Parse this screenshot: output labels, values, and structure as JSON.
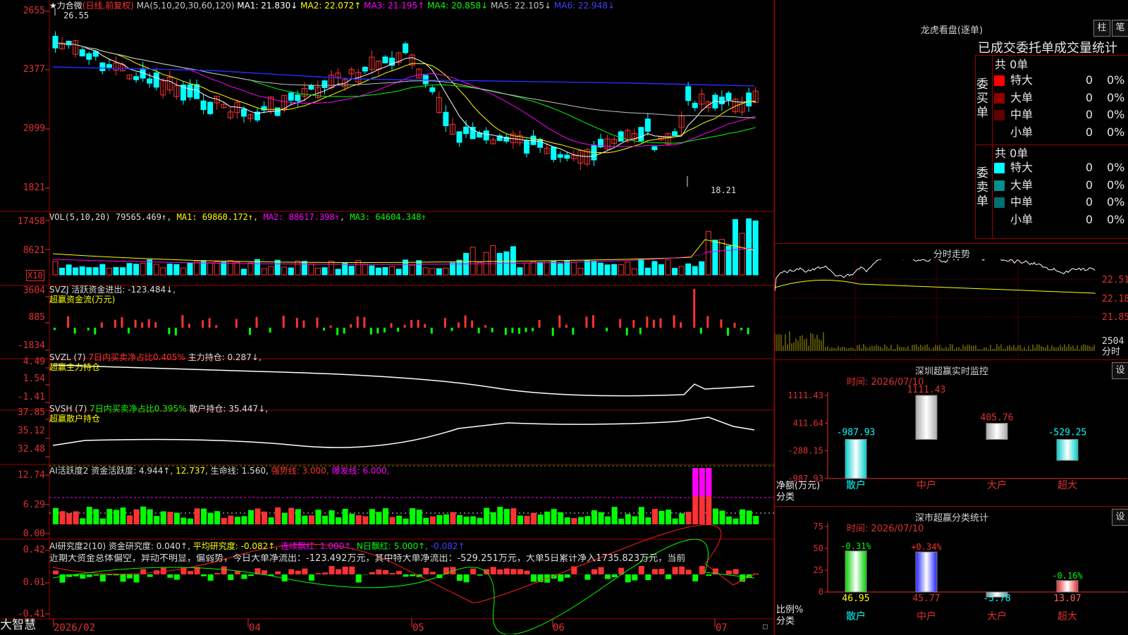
{
  "colors": {
    "up": "#ff3232",
    "down": "#00ffff",
    "ma1": "#ffffff",
    "ma2": "#ffff00",
    "ma3": "#ff00ff",
    "ma4": "#00ff00",
    "ma5": "#c0c0c0",
    "ma6": "#2a2aff",
    "grid": "#a00000"
  },
  "main": {
    "stock_name": "★力合微",
    "mode": "(日线,前复权)",
    "ma_params": "MA(5,10,20,30,60,120)",
    "ma": [
      {
        "label": "MA1: 21.830↓",
        "color": "#ffffff"
      },
      {
        "label": "MA2: 22.072↑",
        "color": "#ffff00"
      },
      {
        "label": "MA3: 21.195↑",
        "color": "#ff00ff"
      },
      {
        "label": "MA4: 20.858↓",
        "color": "#00ff00"
      },
      {
        "label": "MA5: 22.105↓",
        "color": "#c0c0c0"
      },
      {
        "label": "MA6: 22.948↓",
        "color": "#2a2aff"
      }
    ],
    "y_ticks": [
      "2655",
      "2377",
      "2099",
      "1821"
    ],
    "high_marker": "26.55",
    "low_marker": "18.21"
  },
  "vol": {
    "header": "VOL(5,10,20)",
    "value": "79565.469↑",
    "ma1": "MA1: 69860.172↑",
    "ma2": "MA2: 88617.398↑",
    "ma3": "MA3: 64604.348↑",
    "y_ticks": [
      "17458",
      "8621"
    ],
    "unit": "X10"
  },
  "svzj": {
    "header": "SVZJ  活跃资金进出: -123.484↓,",
    "sub": "超赢资金流(万元)",
    "y_ticks": [
      "3604",
      "885",
      "-1834"
    ]
  },
  "svzl": {
    "header": "SVZL (7)",
    "red": "7日内买卖净占比0.405%",
    "tail": "主力持仓: 0.287↓,",
    "sub": "超赢主力持仓",
    "y_ticks": [
      "4.49",
      "1.54",
      "-1.41"
    ]
  },
  "svsh": {
    "header": "SVSH (7)",
    "green": "7日内买卖净占比0.395%",
    "tail": "散户持仓: 35.447↓,",
    "sub": "超赢散户持仓",
    "y_ticks": [
      "37.85",
      "35.12",
      "32.48"
    ]
  },
  "ai1": {
    "a": "AI活跃度2 资金活跃度: 4.944↑,",
    "b": "12.737,",
    "c": "生命线: 1.560,",
    "d": "强势线: 3.000,",
    "e": "爆发线: 6.000,",
    "y_ticks": [
      "12.74",
      "6.29",
      "0.00"
    ]
  },
  "ai2": {
    "a": "AI研究度2(10) 资金研究度: 0.040↑,",
    "b": "平均研究度: -0.082↑,",
    "c": "连续飘红: 1.000↑,",
    "d": "N日飘红: 5.000↑,",
    "e": "-0.082↑",
    "text": "近期大资金总体偏空，异动不明显，偏弱势，今日大单净流出：-123.492万元，其中特大单净流出：-529.251万元，大单5日累计净入1735.823万元，当前",
    "y_ticks": [
      "0.42",
      "0.01",
      "-0.41"
    ]
  },
  "xaxis": {
    "brand": "大智慧",
    "labels": [
      "2026/02",
      "04",
      "05",
      "06",
      "07"
    ]
  },
  "lhb": {
    "title": "龙虎看盘(逐单)",
    "btn1": "柱",
    "btn2": "笔",
    "heading": "已成交委托单成交量统计",
    "buy": {
      "total": "共 0单",
      "side": "委买单",
      "rows": [
        {
          "label": "特大",
          "v": "0",
          "p": "0%",
          "color": "#ff0000"
        },
        {
          "label": "大单",
          "v": "0",
          "p": "0%",
          "color": "#900000"
        },
        {
          "label": "中单",
          "v": "0",
          "p": "0%",
          "color": "#600000"
        },
        {
          "label": "小单",
          "v": "0",
          "p": "0%",
          "color": ""
        }
      ]
    },
    "sell": {
      "total": "共 0单",
      "side": "委卖单",
      "rows": [
        {
          "label": "特大",
          "v": "0",
          "p": "0%",
          "color": "#00ffff"
        },
        {
          "label": "大单",
          "v": "0",
          "p": "0%",
          "color": "#009090"
        },
        {
          "label": "中单",
          "v": "0",
          "p": "0%",
          "color": "#007070"
        },
        {
          "label": "小单",
          "v": "0",
          "p": "0%",
          "color": ""
        }
      ]
    }
  },
  "intraday": {
    "title": "分时走势",
    "y_ticks": [
      "22.51",
      "22.18",
      "21.85",
      "2504"
    ],
    "unit": "分时"
  },
  "monitor": {
    "title": "深圳超赢实时监控",
    "btn": "设",
    "time": "时间: 2026/07/10",
    "y_ticks": [
      "1111.43",
      "411.64",
      "-288.15",
      "-987.93"
    ],
    "ylabel": "净额(万元)",
    "xlabel": "分类",
    "categories": [
      "散户",
      "中户",
      "大户",
      "超大"
    ],
    "values": [
      -987.93,
      1111.43,
      405.76,
      -529.25
    ],
    "value_labels": [
      "-987.93",
      "1111.43",
      "405.76",
      "-529.25"
    ]
  },
  "classify": {
    "title": "深市超赢分类统计",
    "btn": "设",
    "time": "时间: 2026/07/10",
    "y_ticks": [
      "75",
      "50",
      "25",
      "0"
    ],
    "ylabel": "比例%",
    "xlabel": "分类",
    "categories": [
      "散户",
      "中户",
      "大户",
      "超大"
    ],
    "values": [
      46.95,
      45.77,
      -5.78,
      13.07
    ],
    "value_labels": [
      "46.95",
      "45.77",
      "-5.78",
      "13.07"
    ],
    "pct_labels": [
      "-0.31%",
      "+0.34%",
      "",
      "-0.16%"
    ]
  }
}
